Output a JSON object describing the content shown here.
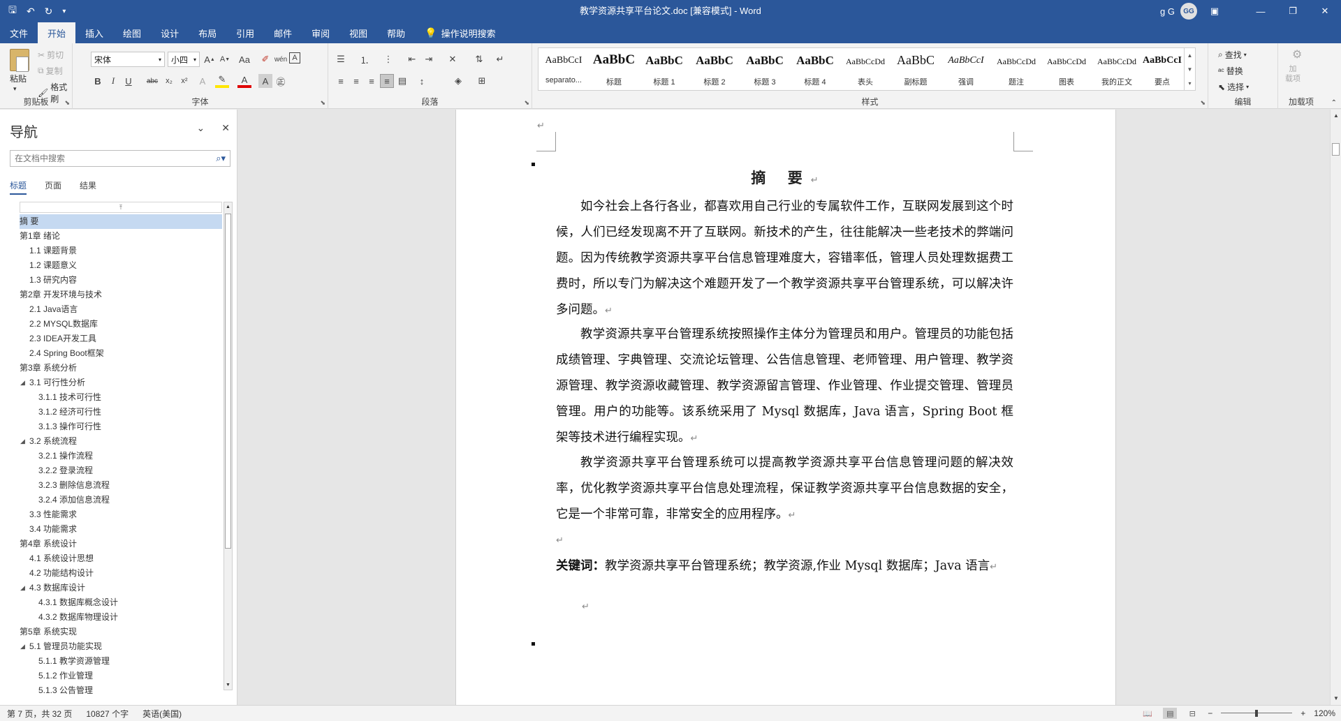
{
  "window": {
    "title": "教学资源共享平台论文.doc [兼容模式]  -  Word",
    "user_name": "g G",
    "user_initials": "GG"
  },
  "tabs": [
    {
      "label": "文件"
    },
    {
      "label": "开始",
      "active": true
    },
    {
      "label": "插入"
    },
    {
      "label": "绘图"
    },
    {
      "label": "设计"
    },
    {
      "label": "布局"
    },
    {
      "label": "引用"
    },
    {
      "label": "邮件"
    },
    {
      "label": "审阅"
    },
    {
      "label": "视图"
    },
    {
      "label": "帮助"
    }
  ],
  "tell_me": "操作说明搜索",
  "ribbon": {
    "clipboard": {
      "label": "剪贴板",
      "paste": "粘贴",
      "cut": "剪切",
      "copy": "复制",
      "format_painter": "格式刷"
    },
    "font": {
      "label": "字体",
      "font_name": "宋体",
      "font_size": "小四"
    },
    "paragraph": {
      "label": "段落"
    },
    "styles": {
      "label": "样式",
      "items": [
        {
          "sample": "AaBbCcI",
          "name": "separato..."
        },
        {
          "sample": "AaBbC",
          "name": "标题"
        },
        {
          "sample": "AaBbC",
          "name": "标题 1"
        },
        {
          "sample": "AaBbC",
          "name": "标题 2"
        },
        {
          "sample": "AaBbC",
          "name": "标题 3"
        },
        {
          "sample": "AaBbC",
          "name": "标题 4"
        },
        {
          "sample": "AaBbCcDd",
          "name": "表头"
        },
        {
          "sample": "AaBbC",
          "name": "副标题"
        },
        {
          "sample": "AaBbCcI",
          "name": "强调"
        },
        {
          "sample": "AaBbCcDd",
          "name": "题注"
        },
        {
          "sample": "AaBbCcDd",
          "name": "图表"
        },
        {
          "sample": "AaBbCcDd",
          "name": "我的正文"
        },
        {
          "sample": "AaBbCcI",
          "name": "要点"
        }
      ]
    },
    "editing": {
      "label": "编辑",
      "find": "查找",
      "replace": "替换",
      "select": "选择"
    },
    "addins": {
      "label": "加载项",
      "button": "加\n载项"
    }
  },
  "nav": {
    "title": "导航",
    "search_placeholder": "在文档中搜索",
    "tabs": [
      "标题",
      "页面",
      "结果"
    ],
    "tree": [
      {
        "label": "摘  要",
        "level": 0,
        "selected": true,
        "toggle": ""
      },
      {
        "label": "第1章 绪论",
        "level": 0,
        "toggle": "◢"
      },
      {
        "label": "1.1 课题背景",
        "level": 1,
        "toggle": ""
      },
      {
        "label": "1.2 课题意义",
        "level": 1,
        "toggle": ""
      },
      {
        "label": "1.3 研究内容",
        "level": 1,
        "toggle": ""
      },
      {
        "label": "第2章 开发环境与技术",
        "level": 0,
        "toggle": "◢"
      },
      {
        "label": "2.1 Java语言",
        "level": 1,
        "toggle": ""
      },
      {
        "label": "2.2 MYSQL数据库",
        "level": 1,
        "toggle": ""
      },
      {
        "label": "2.3 IDEA开发工具",
        "level": 1,
        "toggle": ""
      },
      {
        "label": "2.4 Spring Boot框架",
        "level": 1,
        "toggle": ""
      },
      {
        "label": "第3章 系统分析",
        "level": 0,
        "toggle": "◢"
      },
      {
        "label": "3.1 可行性分析",
        "level": 1,
        "toggle": "◢"
      },
      {
        "label": "3.1.1 技术可行性",
        "level": 2,
        "toggle": ""
      },
      {
        "label": "3.1.2 经济可行性",
        "level": 2,
        "toggle": ""
      },
      {
        "label": "3.1.3 操作可行性",
        "level": 2,
        "toggle": ""
      },
      {
        "label": "3.2 系统流程",
        "level": 1,
        "toggle": "◢"
      },
      {
        "label": "3.2.1 操作流程",
        "level": 2,
        "toggle": ""
      },
      {
        "label": "3.2.2 登录流程",
        "level": 2,
        "toggle": ""
      },
      {
        "label": "3.2.3 删除信息流程",
        "level": 2,
        "toggle": ""
      },
      {
        "label": "3.2.4 添加信息流程",
        "level": 2,
        "toggle": ""
      },
      {
        "label": "3.3 性能需求",
        "level": 1,
        "toggle": ""
      },
      {
        "label": "3.4 功能需求",
        "level": 1,
        "toggle": ""
      },
      {
        "label": "第4章 系统设计",
        "level": 0,
        "toggle": "◢"
      },
      {
        "label": "4.1 系统设计思想",
        "level": 1,
        "toggle": ""
      },
      {
        "label": "4.2 功能结构设计",
        "level": 1,
        "toggle": ""
      },
      {
        "label": "4.3 数据库设计",
        "level": 1,
        "toggle": "◢"
      },
      {
        "label": "4.3.1 数据库概念设计",
        "level": 2,
        "toggle": ""
      },
      {
        "label": "4.3.2 数据库物理设计",
        "level": 2,
        "toggle": ""
      },
      {
        "label": "第5章 系统实现",
        "level": 0,
        "toggle": "◢"
      },
      {
        "label": "5.1 管理员功能实现",
        "level": 1,
        "toggle": "◢"
      },
      {
        "label": "5.1.1 教学资源管理",
        "level": 2,
        "toggle": ""
      },
      {
        "label": "5.1.2 作业管理",
        "level": 2,
        "toggle": ""
      },
      {
        "label": "5.1.3 公告管理",
        "level": 2,
        "toggle": ""
      }
    ]
  },
  "document": {
    "heading": "摘  要",
    "paragraphs": [
      "如今社会上各行各业，都喜欢用自己行业的专属软件工作，互联网发展到这个时候，人们已经发现离不开了互联网。新技术的产生，往往能解决一些老技术的弊端问题。因为传统教学资源共享平台信息管理难度大，容错率低，管理人员处理数据费工费时，所以专门为解决这个难题开发了一个教学资源共享平台管理系统，可以解决许多问题。",
      "教学资源共享平台管理系统按照操作主体分为管理员和用户。管理员的功能包括成绩管理、字典管理、交流论坛管理、公告信息管理、老师管理、用户管理、教学资源管理、教学资源收藏管理、教学资源留言管理、作业管理、作业提交管理、管理员管理。用户的功能等。该系统采用了 Mysql 数据库，Java 语言，Spring Boot 框架等技术进行编程实现。",
      "教学资源共享平台管理系统可以提高教学资源共享平台信息管理问题的解决效率，优化教学资源共享平台信息处理流程，保证教学资源共享平台信息数据的安全，它是一个非常可靠，非常安全的应用程序。"
    ],
    "keywords_label": "关键词：",
    "keywords": "教学资源共享平台管理系统；教学资源,作业 Mysql 数据库；Java 语言"
  },
  "status": {
    "page": "第 7 页，共 32 页",
    "words": "10827 个字",
    "language": "英语(美国)",
    "zoom": "120%",
    "zoom_level": 0.5
  }
}
